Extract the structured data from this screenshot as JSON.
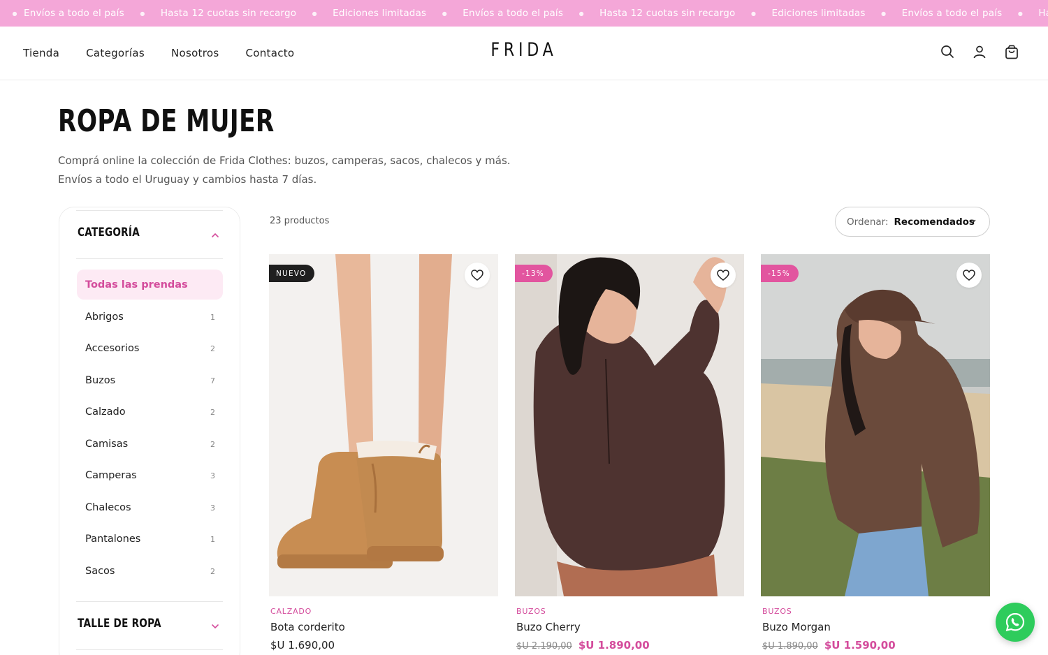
{
  "announcement": {
    "items": [
      "Envíos a todo el país",
      "Hasta 12 cuotas sin recargo",
      "Ediciones limitadas",
      "Envíos a todo el país",
      "Hasta 12 cuotas sin recargo",
      "Ediciones limitadas",
      "Envíos a todo el país",
      "Hasta"
    ],
    "color": "#f4a7d8"
  },
  "header": {
    "nav": [
      "Tienda",
      "Categorías",
      "Nosotros",
      "Contacto"
    ],
    "logo": "FRIDA",
    "icons": [
      "search-icon",
      "account-icon",
      "cart-icon"
    ]
  },
  "page": {
    "title": "ROPA DE MUJER",
    "description_line1": "Comprá online la colección de Frida Clothes: buzos, camperas, sacos, chalecos y más.",
    "description_line2": "Envíos a todo el Uruguay y cambios hasta 7 días."
  },
  "sidebar": {
    "category_heading": "CATEGORÍA",
    "active_item": "Todas las prendas",
    "items": [
      {
        "label": "Abrigos",
        "count": "1"
      },
      {
        "label": "Accesorios",
        "count": "2"
      },
      {
        "label": "Buzos",
        "count": "7"
      },
      {
        "label": "Calzado",
        "count": "2"
      },
      {
        "label": "Camisas",
        "count": "2"
      },
      {
        "label": "Camperas",
        "count": "3"
      },
      {
        "label": "Chalecos",
        "count": "3"
      },
      {
        "label": "Pantalones",
        "count": "1"
      },
      {
        "label": "Sacos",
        "count": "2"
      }
    ],
    "size_heading": "TALLE DE ROPA"
  },
  "toolbar": {
    "product_count": "23 productos",
    "sort_label": "Ordenar:",
    "sort_value": "Recomendados"
  },
  "products": [
    {
      "badge": "NUEVO",
      "category": "CALZADO",
      "name": "Bota corderito",
      "price": "$U 1.690,00",
      "old_price": "",
      "sale_price": ""
    },
    {
      "badge": "-13%",
      "category": "BUZOS",
      "name": "Buzo Cherry",
      "price": "",
      "old_price": "$U 2.190,00",
      "sale_price": "$U 1.890,00"
    },
    {
      "badge": "-15%",
      "category": "BUZOS",
      "name": "Buzo Morgan",
      "price": "",
      "old_price": "$U 1.890,00",
      "sale_price": "$U 1.590,00"
    }
  ],
  "colors": {
    "accent": "#d44c9c",
    "accent_light": "#fdeaf4",
    "whatsapp": "#2ecc5c"
  },
  "floating": {
    "icon": "whatsapp-icon"
  }
}
